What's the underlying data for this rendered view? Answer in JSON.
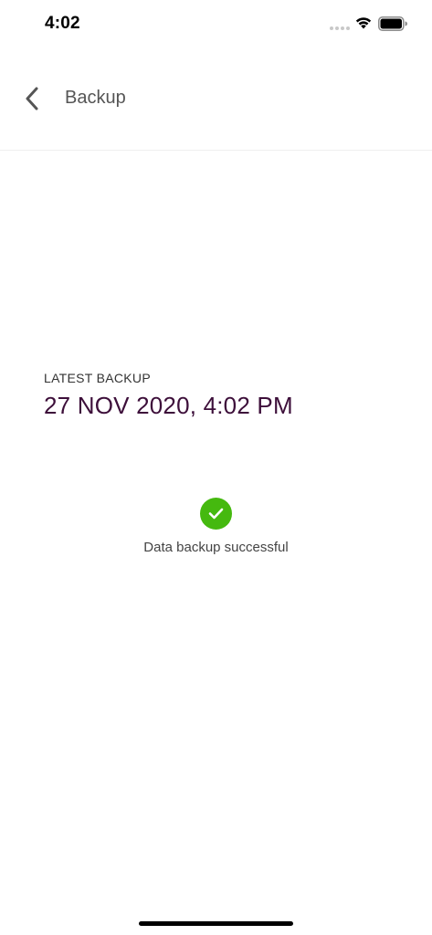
{
  "status_bar": {
    "time": "4:02",
    "icons": [
      "signal-dots-icon",
      "wifi-icon",
      "battery-icon"
    ]
  },
  "header": {
    "back_icon": "chevron-left-icon",
    "title": "Backup"
  },
  "backup": {
    "label": "LATEST BACKUP",
    "date": "27 NOV 2020, 4:02 PM"
  },
  "status": {
    "icon": "checkmark-icon",
    "message": "Data backup successful",
    "accent_color": "#45b90f"
  },
  "colors": {
    "date_text": "#3d0f3a",
    "success": "#45b90f"
  }
}
